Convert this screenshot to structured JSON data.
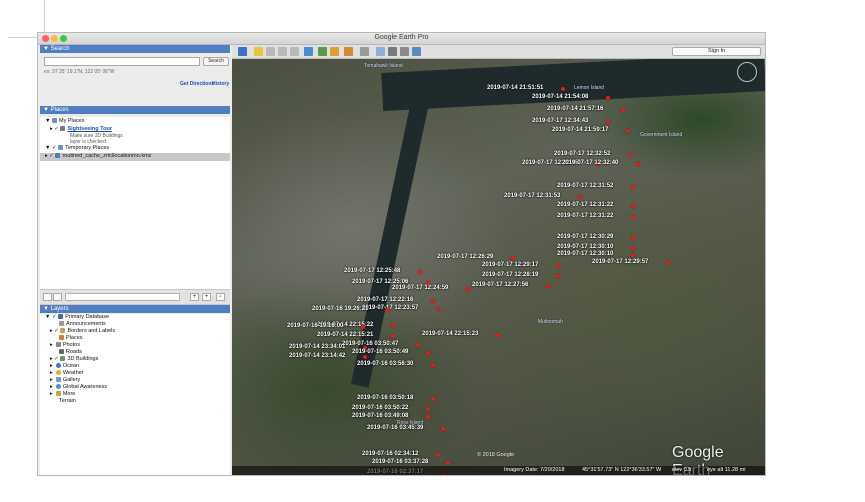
{
  "window": {
    "title": "Google Earth Pro"
  },
  "toolbar": {
    "sign_in": "Sign In"
  },
  "search": {
    "header": "Search",
    "input_value": "",
    "button": "Search",
    "hint": "ex: 37 25' 19.1\"N, 122 05' 06\"W",
    "get_directions": "Get Directions",
    "history": "History"
  },
  "places": {
    "header": "Places",
    "my_places": "My Places",
    "tour": "Sightseeing Tour",
    "tour_note_1": "Make sure 3D Buildings",
    "tour_note_2": "layer is checked",
    "temporary": "Temporary Places",
    "kmz_file": "routined_cache_zrtcllocationmo.kmz"
  },
  "layers": {
    "header": "Layers",
    "items": [
      "Primary Database",
      "Announcements",
      "Borders and Labels",
      "Places",
      "Photos",
      "Roads",
      "3D Buildings",
      "Ocean",
      "Weather",
      "Gallery",
      "Global Awareness",
      "More",
      "Terrain"
    ]
  },
  "map": {
    "place_names": [
      "Tomahawk Island",
      "Lemon Island",
      "Government Island",
      "Multnomah",
      "Ross Island"
    ],
    "labels": [
      "2019-07-14 21:51:51",
      "2019-07-14 21:54:08",
      "2019-07-14 21:57:16",
      "2019-07-14 21:59:17",
      "2019-07-17 12:34:43",
      "2019-07-17 12:32:52",
      "2019-07-17 12:32:45",
      "2019-07-17 12:32:40",
      "2019-07-17 12:31:53",
      "2019-07-17 12:31:52",
      "2019-07-17 12:31:22",
      "2019-07-17 12:31:22",
      "2019-07-17 12:30:29",
      "2019-07-17 12:30:10",
      "2019-07-17 12:30:10",
      "2019-07-17 12:29:57",
      "2019-07-17 12:29:17",
      "2019-07-17 12:28:19",
      "2019-07-17 12:27:56",
      "2019-07-17 12:26:29",
      "2019-07-17 12:25:48",
      "2019-07-17 12:24:59",
      "2019-07-17 12:23:57",
      "2019-07-17 12:25:06",
      "2019-07-17 12:22:16",
      "2019-07-14 22:15:22",
      "2019-07-14 22:15:23",
      "2019-07-14 22:15:21",
      "2019-07-16 19:16:00",
      "2019-07-16 19:26:21",
      "2019-07-14 23:34:01",
      "2019-07-14 23:14:42",
      "2019-07-16 03:50:47",
      "2019-07-16 03:50:49",
      "2019-07-16 03:56:30",
      "2019-07-16 03:50:18",
      "2019-07-16 03:50:22",
      "2019-07-16 03:49:08",
      "2019-07-16 03:45:39",
      "2019-07-16 02:34:12",
      "2019-07-16 03:37:28",
      "2019-07-16 02:37:17"
    ],
    "copyright": "© 2018 Google",
    "logo": "Google Earth",
    "imagery_date": "Imagery Date: 7/20/2018",
    "coords": "45°31'57.73\" N  122°36'33.57\" W",
    "elev": "elev  0 ft",
    "eye_alt": "eye alt  11.28 mi"
  }
}
